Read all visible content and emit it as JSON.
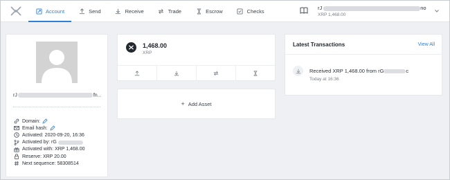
{
  "nav": {
    "items": [
      {
        "label": "Account",
        "icon": "account-icon",
        "active": true
      },
      {
        "label": "Send",
        "icon": "send-icon"
      },
      {
        "label": "Receive",
        "icon": "receive-icon"
      },
      {
        "label": "Trade",
        "icon": "trade-icon"
      },
      {
        "label": "Escrow",
        "icon": "hourglass-icon"
      },
      {
        "label": "Checks",
        "icon": "checks-icon"
      }
    ],
    "accent_color": "#2e7fd6"
  },
  "account_switcher": {
    "address_prefix": "rJ",
    "address_suffix": "no",
    "balance": "XRP 1,468.00"
  },
  "profile": {
    "address_prefix": "rJ",
    "address_suffix": "fn...",
    "rows": {
      "domain": "Domain:",
      "email_hash": "Email hash:",
      "activated": "Activated: 2020-09-20, 16:36",
      "activated_by": "Activated by: rG",
      "activated_with": "Activated with: XRP 1,468.00",
      "reserve": "Reserve: XRP 20.00",
      "next_sequence": "Next sequence: 58308514"
    }
  },
  "asset": {
    "amount": "1,468.00",
    "currency": "XRP"
  },
  "add_asset": {
    "plus": "+",
    "label": "Add Asset"
  },
  "latest": {
    "title": "Latest Transactions",
    "view_all": "View All",
    "tx_prefix": "Received XRP 1,468.00 from rG",
    "tx_suffix": "c",
    "tx_time": "Today at 16:36"
  }
}
